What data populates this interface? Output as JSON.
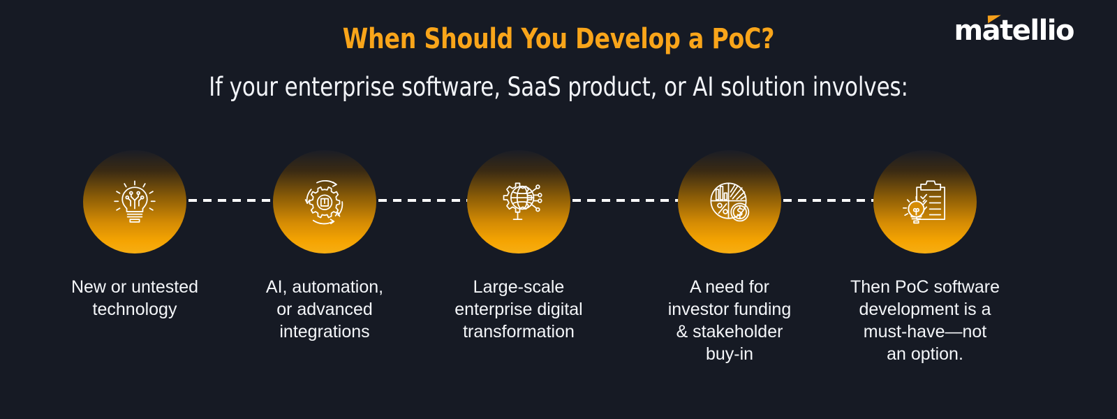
{
  "brand": {
    "logo_text": "matellio",
    "accent_color": "#f5a01b"
  },
  "header": {
    "title": "When Should You Develop a PoC?",
    "title_color": "#f9a51a",
    "subtitle": "If your enterprise software, SaaS product, or AI solution involves:",
    "subtitle_color": "#f2f4f8"
  },
  "theme": {
    "background": "#161a24",
    "bubble_gradient_top": "#1a1d26",
    "bubble_gradient_bottom": "#f5a402",
    "connector_color": "#ffffff"
  },
  "steps": [
    {
      "icon": "lightbulb-circuit-icon",
      "caption": "New or untested\ntechnology"
    },
    {
      "icon": "gear-automation-cycle-icon",
      "caption": "AI, automation,\nor advanced\nintegrations"
    },
    {
      "icon": "gear-globe-network-icon",
      "caption": "Large-scale\nenterprise digital\ntransformation"
    },
    {
      "icon": "pie-chart-dollar-icon",
      "caption": "A need for\ninvestor funding\n& stakeholder\nbuy-in"
    },
    {
      "icon": "clipboard-checklist-lightbulb-icon",
      "caption": "Then PoC software\ndevelopment is a\nmust-have—not\nan option."
    }
  ]
}
